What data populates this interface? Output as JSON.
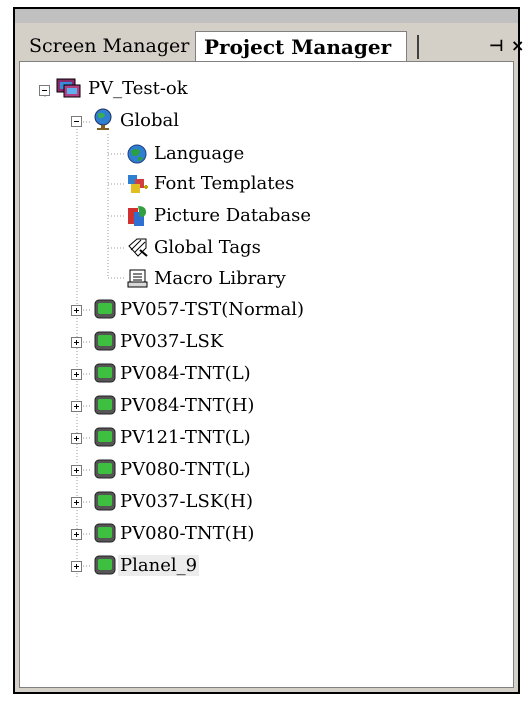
{
  "tabs": {
    "screen_manager": "Screen Manager",
    "project_manager": "Project Manager"
  },
  "window_controls": {
    "pin": "⊣",
    "close": "×"
  },
  "tree": {
    "root": {
      "label": "PV_Test-ok",
      "expanded": true,
      "icon": "project-icon"
    },
    "global": {
      "label": "Global",
      "expanded": true,
      "icon": "globe-icon"
    },
    "global_children": [
      {
        "label": "Language",
        "icon": "language-globe-icon"
      },
      {
        "label": "Font Templates",
        "icon": "font-templates-icon"
      },
      {
        "label": "Picture Database",
        "icon": "picture-database-icon"
      },
      {
        "label": "Global Tags",
        "icon": "global-tags-icon"
      },
      {
        "label": "Macro Library",
        "icon": "macro-library-icon"
      }
    ],
    "panels": [
      {
        "label": "PV057-TST(Normal)",
        "expanded": false
      },
      {
        "label": "PV037-LSK",
        "expanded": false
      },
      {
        "label": "PV084-TNT(L)",
        "expanded": false
      },
      {
        "label": "PV084-TNT(H)",
        "expanded": false
      },
      {
        "label": "PV121-TNT(L)",
        "expanded": false
      },
      {
        "label": "PV080-TNT(L)",
        "expanded": false
      },
      {
        "label": "PV037-LSK(H)",
        "expanded": false
      },
      {
        "label": "PV080-TNT(H)",
        "expanded": false
      },
      {
        "label": "Planel_9",
        "expanded": false,
        "selected": true
      }
    ]
  },
  "colors": {
    "panel_icon_green": "#3fbf3f",
    "selection": "#ececec"
  }
}
